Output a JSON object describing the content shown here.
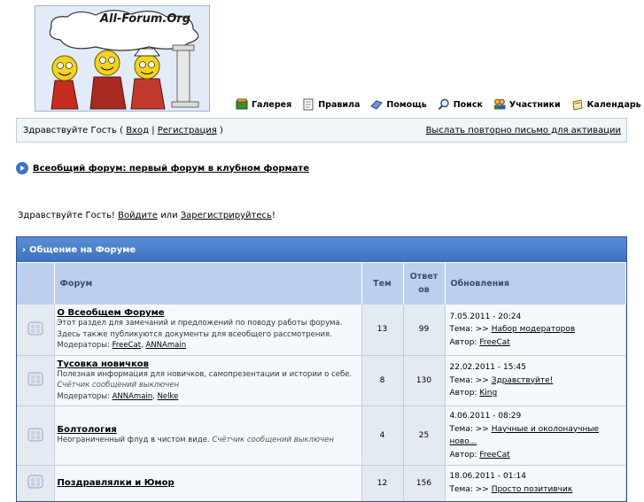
{
  "site": {
    "logo_text": "All-Forum.Org"
  },
  "nav": [
    {
      "label": "Галерея",
      "icon": "gallery-icon"
    },
    {
      "label": "Правила",
      "icon": "rules-icon"
    },
    {
      "label": "Помощь",
      "icon": "help-icon"
    },
    {
      "label": "Поиск",
      "icon": "search-icon"
    },
    {
      "label": "Участники",
      "icon": "members-icon"
    },
    {
      "label": "Календарь",
      "icon": "calendar-icon"
    }
  ],
  "userbar": {
    "greeting_prefix": "Здравствуйте Гость (",
    "login": "Вход",
    "sep": "|",
    "register": "Регистрация",
    "greeting_suffix": ")",
    "resend": "Выслать повторно письмо для активации"
  },
  "navstrip": {
    "title": "Всеобщий форум: первый форум в клубном формате"
  },
  "welcome": {
    "prefix": "Здравствуйте Гость!",
    "login": "Войдите",
    "or": "или",
    "register": "Зарегистрируйтесь",
    "suffix": "!"
  },
  "category": {
    "title": "Общение на Форуме",
    "headers": {
      "forum": "Форум",
      "topics": "Тем",
      "replies": "Ответов",
      "updates": "Обновления"
    }
  },
  "forums": [
    {
      "title": "О Всеобщем Форуме",
      "desc": "Этот раздел для замечаний и предложений по поводу работы форума. Здесь также публикуются документы для всеобщего рассмотрения.",
      "note": "",
      "mods_label": "Модераторы:",
      "mods": [
        "FreeCat",
        "ANNAmain"
      ],
      "topics": "13",
      "replies": "99",
      "date": "7.05.2011 - 20:24",
      "topic_label": "Тема: >>",
      "topic": "Набор модераторов",
      "author_label": "Автор:",
      "author": "FreeCat"
    },
    {
      "title": "Тусовка новичков",
      "desc": "Полезная информация для новичков, самопрезентации и истории о себе.",
      "note": "Счётчик сообщений выключен",
      "mods_label": "Модераторы:",
      "mods": [
        "ANNAmain",
        "Nelke"
      ],
      "topics": "8",
      "replies": "130",
      "date": "22.02.2011 - 15:45",
      "topic_label": "Тема: >>",
      "topic": "Здравствуйте!",
      "author_label": "Автор:",
      "author": "King"
    },
    {
      "title": "Болтология",
      "desc": "Неограниченный флуд в чистом виде.",
      "note": "Счётчик сообщений выключен",
      "mods_label": "",
      "mods": [],
      "topics": "4",
      "replies": "25",
      "date": "4.06.2011 - 08:29",
      "topic_label": "Тема: >>",
      "topic": "Научные и околонаучные ново...",
      "author_label": "Автор:",
      "author": "FreeCat"
    },
    {
      "title": "Поздравлялки и Юмор",
      "desc": "",
      "note": "",
      "mods_label": "",
      "mods": [],
      "topics": "12",
      "replies": "156",
      "date": "18.06.2011 - 01:14",
      "topic_label": "Тема: >>",
      "topic": "Просто позитивчик",
      "author_label": "",
      "author": ""
    }
  ]
}
